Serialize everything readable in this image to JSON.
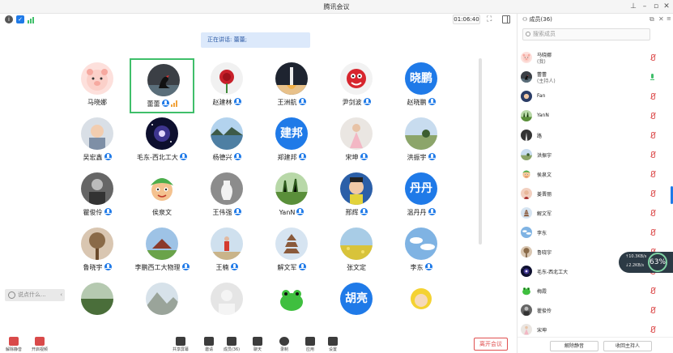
{
  "window": {
    "title": "腾讯会议"
  },
  "toolbar": {
    "timer": "01:06:40"
  },
  "speaking": {
    "text": "正在讲话: 蕾蕾;"
  },
  "grid": [
    {
      "name": "马晓娜",
      "avatar": "pig",
      "mic": false
    },
    {
      "name": "蕾蕾",
      "avatar": "swan",
      "mic": true,
      "signal": true,
      "active": true
    },
    {
      "name": "赵建林",
      "avatar": "rose",
      "mic": true
    },
    {
      "name": "王洲航",
      "avatar": "rocket",
      "mic": true
    },
    {
      "name": "尹剑波",
      "avatar": "toy",
      "mic": true
    },
    {
      "name": "赵晓鹏",
      "avatar_text": "晓鹏",
      "mic": true
    },
    {
      "name": "吴宏鑫",
      "avatar": "baby",
      "mic": true
    },
    {
      "name": "毛东-西北工大",
      "avatar": "galaxy",
      "mic": true
    },
    {
      "name": "杨德兴",
      "avatar": "lake",
      "mic": true
    },
    {
      "name": "郑建邦",
      "avatar_text": "建邦",
      "mic": true
    },
    {
      "name": "宋坤",
      "avatar": "girl",
      "mic": true
    },
    {
      "name": "洪振宇",
      "avatar": "field",
      "mic": true
    },
    {
      "name": "瞿俊伶",
      "avatar": "bw",
      "mic": true
    },
    {
      "name": "侯泉文",
      "avatar": "cartoon",
      "mic": false
    },
    {
      "name": "王伟强",
      "avatar": "vase",
      "mic": true
    },
    {
      "name": "YanN",
      "avatar": "grass",
      "mic": true
    },
    {
      "name": "邢辉",
      "avatar": "kid",
      "mic": true
    },
    {
      "name": "温丹丹",
      "avatar_text": "丹丹",
      "mic": true
    },
    {
      "name": "鲁晓宇",
      "avatar": "tree",
      "mic": true
    },
    {
      "name": "李鹏西工大物理",
      "avatar": "temple",
      "mic": true
    },
    {
      "name": "王楠",
      "avatar": "person",
      "mic": true
    },
    {
      "name": "解文军",
      "avatar": "pagoda",
      "mic": true
    },
    {
      "name": "张文定",
      "avatar": "flowers",
      "mic": false
    },
    {
      "name": "李东",
      "avatar": "sky",
      "mic": true
    },
    {
      "name": "",
      "avatar": "forest",
      "mic": false
    },
    {
      "name": "",
      "avatar": "mountain",
      "mic": false
    },
    {
      "name": "",
      "avatar": "blank",
      "mic": false
    },
    {
      "name": "",
      "avatar": "frog",
      "mic": false
    },
    {
      "name": "",
      "avatar_text": "胡亮",
      "mic": false
    },
    {
      "name": "",
      "avatar": "yellowkid",
      "mic": false
    }
  ],
  "chat": {
    "placeholder": "说点什么..."
  },
  "bottombar": {
    "items": [
      "解除静音",
      "开启视频",
      "共享屏幕",
      "邀请",
      "成员(36)",
      "聊天",
      "录制",
      "应用",
      "设置"
    ],
    "leave": "离开会议"
  },
  "panel": {
    "title": "成员(36)",
    "search_placeholder": "搜索成员",
    "members": [
      {
        "name": "马晓娜",
        "sub": "(我)",
        "avatar": "pig",
        "muted": true
      },
      {
        "name": "蕾蕾",
        "sub": "(主持人)",
        "avatar": "swan",
        "muted": false
      },
      {
        "name": "Fan",
        "avatar": "fan",
        "muted": true
      },
      {
        "name": "YanN",
        "avatar": "grass",
        "muted": true
      },
      {
        "name": "路",
        "avatar": "road",
        "muted": true
      },
      {
        "name": "洪振宇",
        "avatar": "field",
        "muted": true
      },
      {
        "name": "侯泉文",
        "avatar": "cartoon",
        "muted": true
      },
      {
        "name": "姜晋丽",
        "avatar": "woman",
        "muted": true
      },
      {
        "name": "解文军",
        "avatar": "pagoda",
        "muted": true
      },
      {
        "name": "李东",
        "avatar": "sky",
        "muted": true
      },
      {
        "name": "鲁晓宇",
        "avatar": "tree",
        "muted": true
      },
      {
        "name": "毛东-西北工大",
        "avatar": "galaxy",
        "muted": true
      },
      {
        "name": "梅霞",
        "avatar": "frog",
        "muted": true
      },
      {
        "name": "瞿俊伶",
        "avatar": "bw",
        "muted": true
      },
      {
        "name": "宋坤",
        "avatar": "girl",
        "muted": true
      }
    ],
    "mute_all": "解除静音",
    "reclaim_host": "收回主持人"
  },
  "network": {
    "up": "↑10.3KB/s",
    "down": "↓2.2KB/s",
    "quality": "63%"
  },
  "colors": {
    "accent": "#1f7ae8",
    "active_border": "#3fbf6a",
    "leave": "#e05050"
  }
}
